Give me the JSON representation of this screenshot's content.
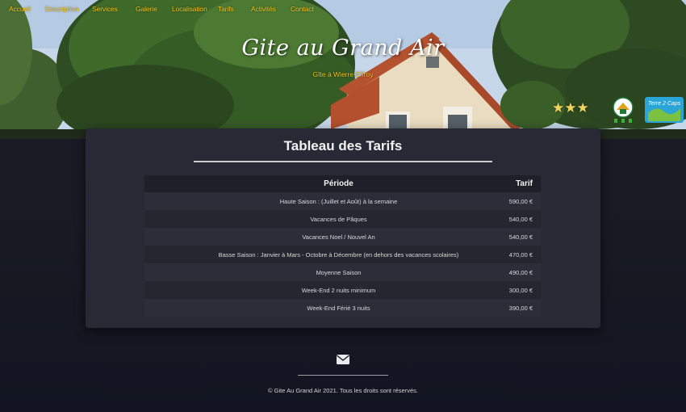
{
  "nav": {
    "items": [
      "Accueil",
      "Description",
      "Services",
      "Galerie",
      "Localisation",
      "Tarifs",
      "Activités",
      "Contact"
    ]
  },
  "hero": {
    "title": "Gite au Grand Air",
    "subtitle": "Gîte à Wierre Effroy",
    "stars": "★★★",
    "star_color": "#f2d55c",
    "logos": [
      "gites-de-france-logo",
      "terre-2-caps-logo"
    ],
    "logo_text_terre": "Terre 2 Caps"
  },
  "tarifs": {
    "title": "Tableau des Tarifs",
    "headers": {
      "periode": "Période",
      "tarif": "Tarif"
    },
    "rows": [
      {
        "periode": "Haute Saison : (Juillet et Août) à la semaine",
        "tarif": "590,00 €"
      },
      {
        "periode": "Vacances de Pâques",
        "tarif": "540,00 €"
      },
      {
        "periode": "Vacances Noel / Nouvel An",
        "tarif": "540,00 €"
      },
      {
        "periode": "Basse Saison : Janvier à Mars - Octobre à Décembre (en dehors des vacances scolaires)",
        "tarif": "470,00 €"
      },
      {
        "periode": "Moyenne Saison",
        "tarif": "490,00 €"
      },
      {
        "periode": "Week-End 2 nuits minimum",
        "tarif": "300,00 €"
      },
      {
        "periode": "Week-End Férié 3 nuits",
        "tarif": "390,00 €"
      }
    ]
  },
  "footer": {
    "icon": "envelope-icon",
    "copyright": "© Gite Au Grand Air 2021. Tous les droits sont réservés."
  },
  "colors": {
    "accent": "#f4c20d",
    "card_bg": "#272a35",
    "page_bg": "#171a23"
  }
}
